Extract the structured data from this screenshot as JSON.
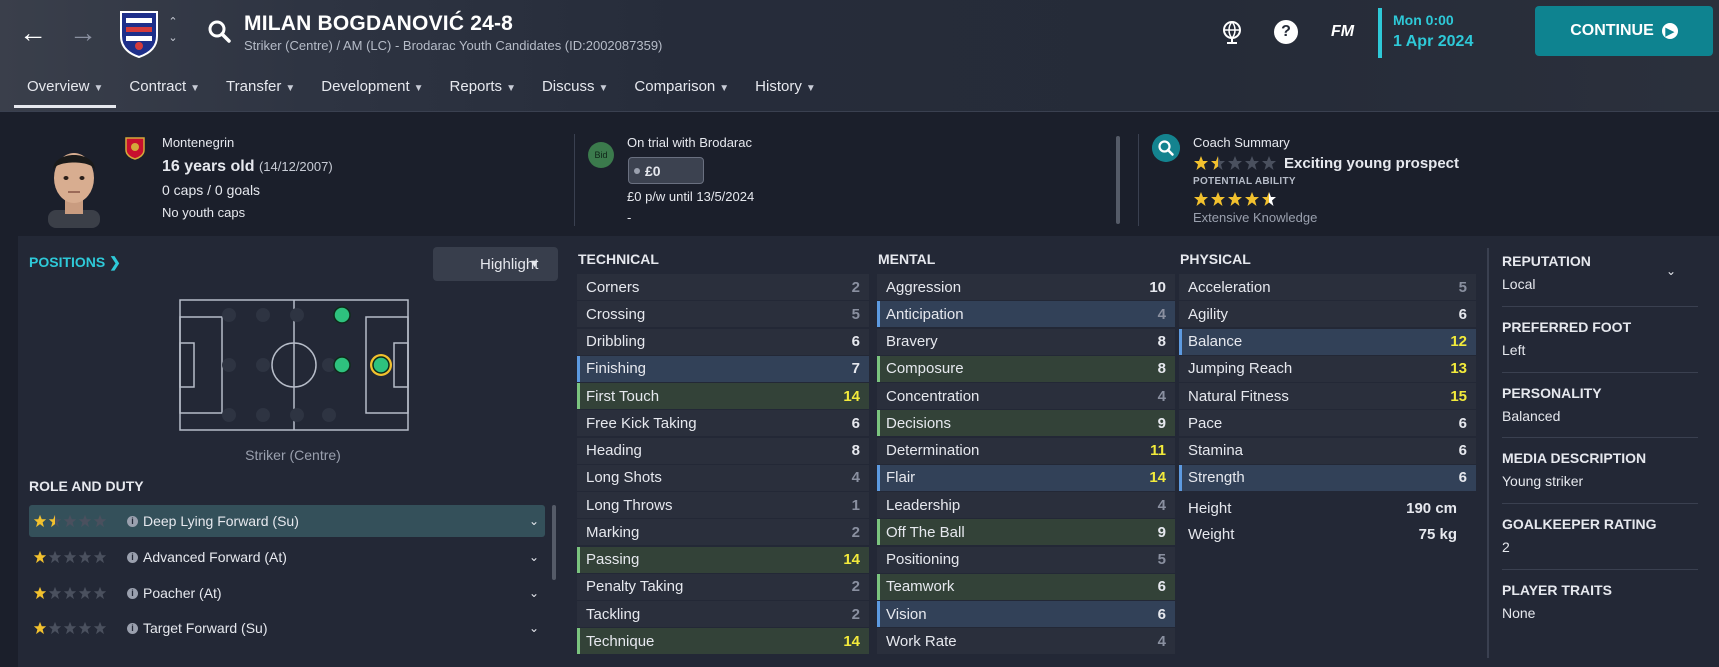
{
  "header": {
    "player_name": "MILAN BOGDANOVIĆ 24-8",
    "subtitle": "Striker (Centre) / AM (LC) - Brodarac Youth Candidates (ID:2002087359)",
    "fm_label": "FM",
    "date_line1": "Mon 0:00",
    "date_line2": "1 Apr 2024",
    "continue_label": "CONTINUE"
  },
  "nav": {
    "tabs": [
      {
        "label": "Overview"
      },
      {
        "label": "Contract"
      },
      {
        "label": "Transfer"
      },
      {
        "label": "Development"
      },
      {
        "label": "Reports"
      },
      {
        "label": "Discuss"
      },
      {
        "label": "Comparison"
      },
      {
        "label": "History"
      }
    ]
  },
  "profile": {
    "nationality": "Montenegrin",
    "age": "16 years old",
    "dob": "(14/12/2007)",
    "caps": "0 caps / 0 goals",
    "youth_caps": "No youth caps"
  },
  "trial": {
    "bid_label": "Bid",
    "status": "On trial with Brodarac",
    "fee": "£0",
    "wage": "£0 p/w until 13/5/2024",
    "dash": "-"
  },
  "coach": {
    "title": "Coach Summary",
    "current_ability_stars": 1.5,
    "summary": "Exciting young prospect",
    "pa_label": "POTENTIAL ABILITY",
    "potential_ability_stars": 4.5,
    "knowledge": "Extensive Knowledge"
  },
  "positions": {
    "link_label": "POSITIONS",
    "highlight_label": "Highlight",
    "caption": "Striker (Centre)"
  },
  "roles": {
    "title": "ROLE AND DUTY",
    "items": [
      {
        "name": "Deep Lying Forward (Su)",
        "stars": 1.5,
        "selected": true
      },
      {
        "name": "Advanced Forward (At)",
        "stars": 1,
        "selected": false
      },
      {
        "name": "Poacher (At)",
        "stars": 1,
        "selected": false
      },
      {
        "name": "Target Forward (Su)",
        "stars": 1,
        "selected": false
      }
    ]
  },
  "technical": {
    "title": "TECHNICAL",
    "rows": [
      {
        "name": "Corners",
        "value": "2",
        "hl": ""
      },
      {
        "name": "Crossing",
        "value": "5",
        "hl": ""
      },
      {
        "name": "Dribbling",
        "value": "6",
        "hl": ""
      },
      {
        "name": "Finishing",
        "value": "7",
        "hl": "b"
      },
      {
        "name": "First Touch",
        "value": "14",
        "hl": "g"
      },
      {
        "name": "Free Kick Taking",
        "value": "6",
        "hl": ""
      },
      {
        "name": "Heading",
        "value": "8",
        "hl": ""
      },
      {
        "name": "Long Shots",
        "value": "4",
        "hl": ""
      },
      {
        "name": "Long Throws",
        "value": "1",
        "hl": ""
      },
      {
        "name": "Marking",
        "value": "2",
        "hl": ""
      },
      {
        "name": "Passing",
        "value": "14",
        "hl": "g"
      },
      {
        "name": "Penalty Taking",
        "value": "2",
        "hl": ""
      },
      {
        "name": "Tackling",
        "value": "2",
        "hl": ""
      },
      {
        "name": "Technique",
        "value": "14",
        "hl": "g"
      }
    ]
  },
  "mental": {
    "title": "MENTAL",
    "rows": [
      {
        "name": "Aggression",
        "value": "10",
        "hl": ""
      },
      {
        "name": "Anticipation",
        "value": "4",
        "hl": "b"
      },
      {
        "name": "Bravery",
        "value": "8",
        "hl": ""
      },
      {
        "name": "Composure",
        "value": "8",
        "hl": "g"
      },
      {
        "name": "Concentration",
        "value": "4",
        "hl": ""
      },
      {
        "name": "Decisions",
        "value": "9",
        "hl": "g"
      },
      {
        "name": "Determination",
        "value": "11",
        "hl": ""
      },
      {
        "name": "Flair",
        "value": "14",
        "hl": "b"
      },
      {
        "name": "Leadership",
        "value": "4",
        "hl": ""
      },
      {
        "name": "Off The Ball",
        "value": "9",
        "hl": "g"
      },
      {
        "name": "Positioning",
        "value": "5",
        "hl": ""
      },
      {
        "name": "Teamwork",
        "value": "6",
        "hl": "g"
      },
      {
        "name": "Vision",
        "value": "6",
        "hl": "b"
      },
      {
        "name": "Work Rate",
        "value": "4",
        "hl": ""
      }
    ]
  },
  "physical": {
    "title": "PHYSICAL",
    "rows": [
      {
        "name": "Acceleration",
        "value": "5",
        "hl": ""
      },
      {
        "name": "Agility",
        "value": "6",
        "hl": ""
      },
      {
        "name": "Balance",
        "value": "12",
        "hl": "b"
      },
      {
        "name": "Jumping Reach",
        "value": "13",
        "hl": ""
      },
      {
        "name": "Natural Fitness",
        "value": "15",
        "hl": ""
      },
      {
        "name": "Pace",
        "value": "6",
        "hl": ""
      },
      {
        "name": "Stamina",
        "value": "6",
        "hl": ""
      },
      {
        "name": "Strength",
        "value": "6",
        "hl": "b"
      }
    ],
    "height_label": "Height",
    "height": "190 cm",
    "weight_label": "Weight",
    "weight": "75 kg"
  },
  "details": {
    "reputation_label": "REPUTATION",
    "reputation": "Local",
    "foot_label": "PREFERRED FOOT",
    "foot": "Left",
    "personality_label": "PERSONALITY",
    "personality": "Balanced",
    "media_label": "MEDIA DESCRIPTION",
    "media": "Young striker",
    "gk_label": "GOALKEEPER RATING",
    "gk": "2",
    "traits_label": "PLAYER TRAITS",
    "traits": "None"
  },
  "colors": {
    "accent": "#2ec9d8",
    "continue_bg": "#0e8390",
    "star_gold": "#f2c12e",
    "high_value": "#f2ea3b",
    "pitch_dot": "#2ec27e"
  }
}
